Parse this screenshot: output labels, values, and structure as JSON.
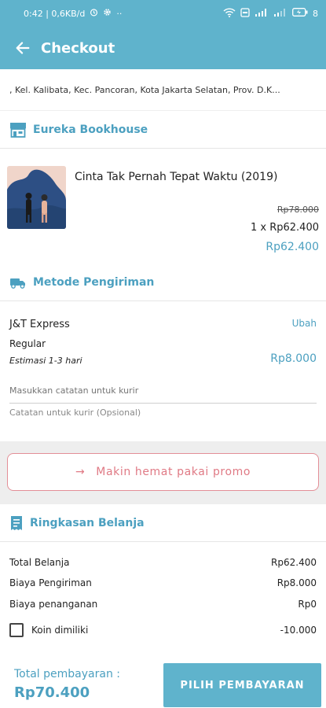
{
  "status": {
    "time_info": "0:42 | 0,6KB/d",
    "battery": "8"
  },
  "header": {
    "title": "Checkout"
  },
  "address": {
    "text": ", Kel. Kalibata, Kec. Pancoran, Kota Jakarta Selatan, Prov. D.K..."
  },
  "store": {
    "name": "Eureka Bookhouse",
    "item": {
      "title": "Cinta Tak Pernah Tepat Waktu (2019)",
      "price_original": "Rp78.000",
      "qty_price": "1 x Rp62.400",
      "total": "Rp62.400"
    }
  },
  "shipping": {
    "heading": "Metode Pengiriman",
    "courier": "J&T Express",
    "change_label": "Ubah",
    "service": "Regular",
    "estimate": "Estimasi 1-3 hari",
    "price": "Rp8.000",
    "note_placeholder": "Masukkan catatan untuk kurir",
    "note_hint": "Catatan untuk kurir (Opsional)"
  },
  "promo": {
    "label": "Makin hemat pakai promo"
  },
  "summary": {
    "heading": "Ringkasan Belanja",
    "rows": [
      {
        "label": "Total Belanja",
        "value": "Rp62.400"
      },
      {
        "label": "Biaya Pengiriman",
        "value": "Rp8.000"
      },
      {
        "label": "Biaya penanganan",
        "value": "Rp0"
      }
    ],
    "coin_label": "Koin dimiliki",
    "coin_value": "-10.000",
    "coin_checked": false
  },
  "footer": {
    "total_label": "Total pembayaran :",
    "total_value": "Rp70.400",
    "pay_button": "PILIH PEMBAYARAN"
  },
  "colors": {
    "primary": "#5fb3cc",
    "accent_text": "#4ca0c0",
    "promo": "#e07a85"
  }
}
